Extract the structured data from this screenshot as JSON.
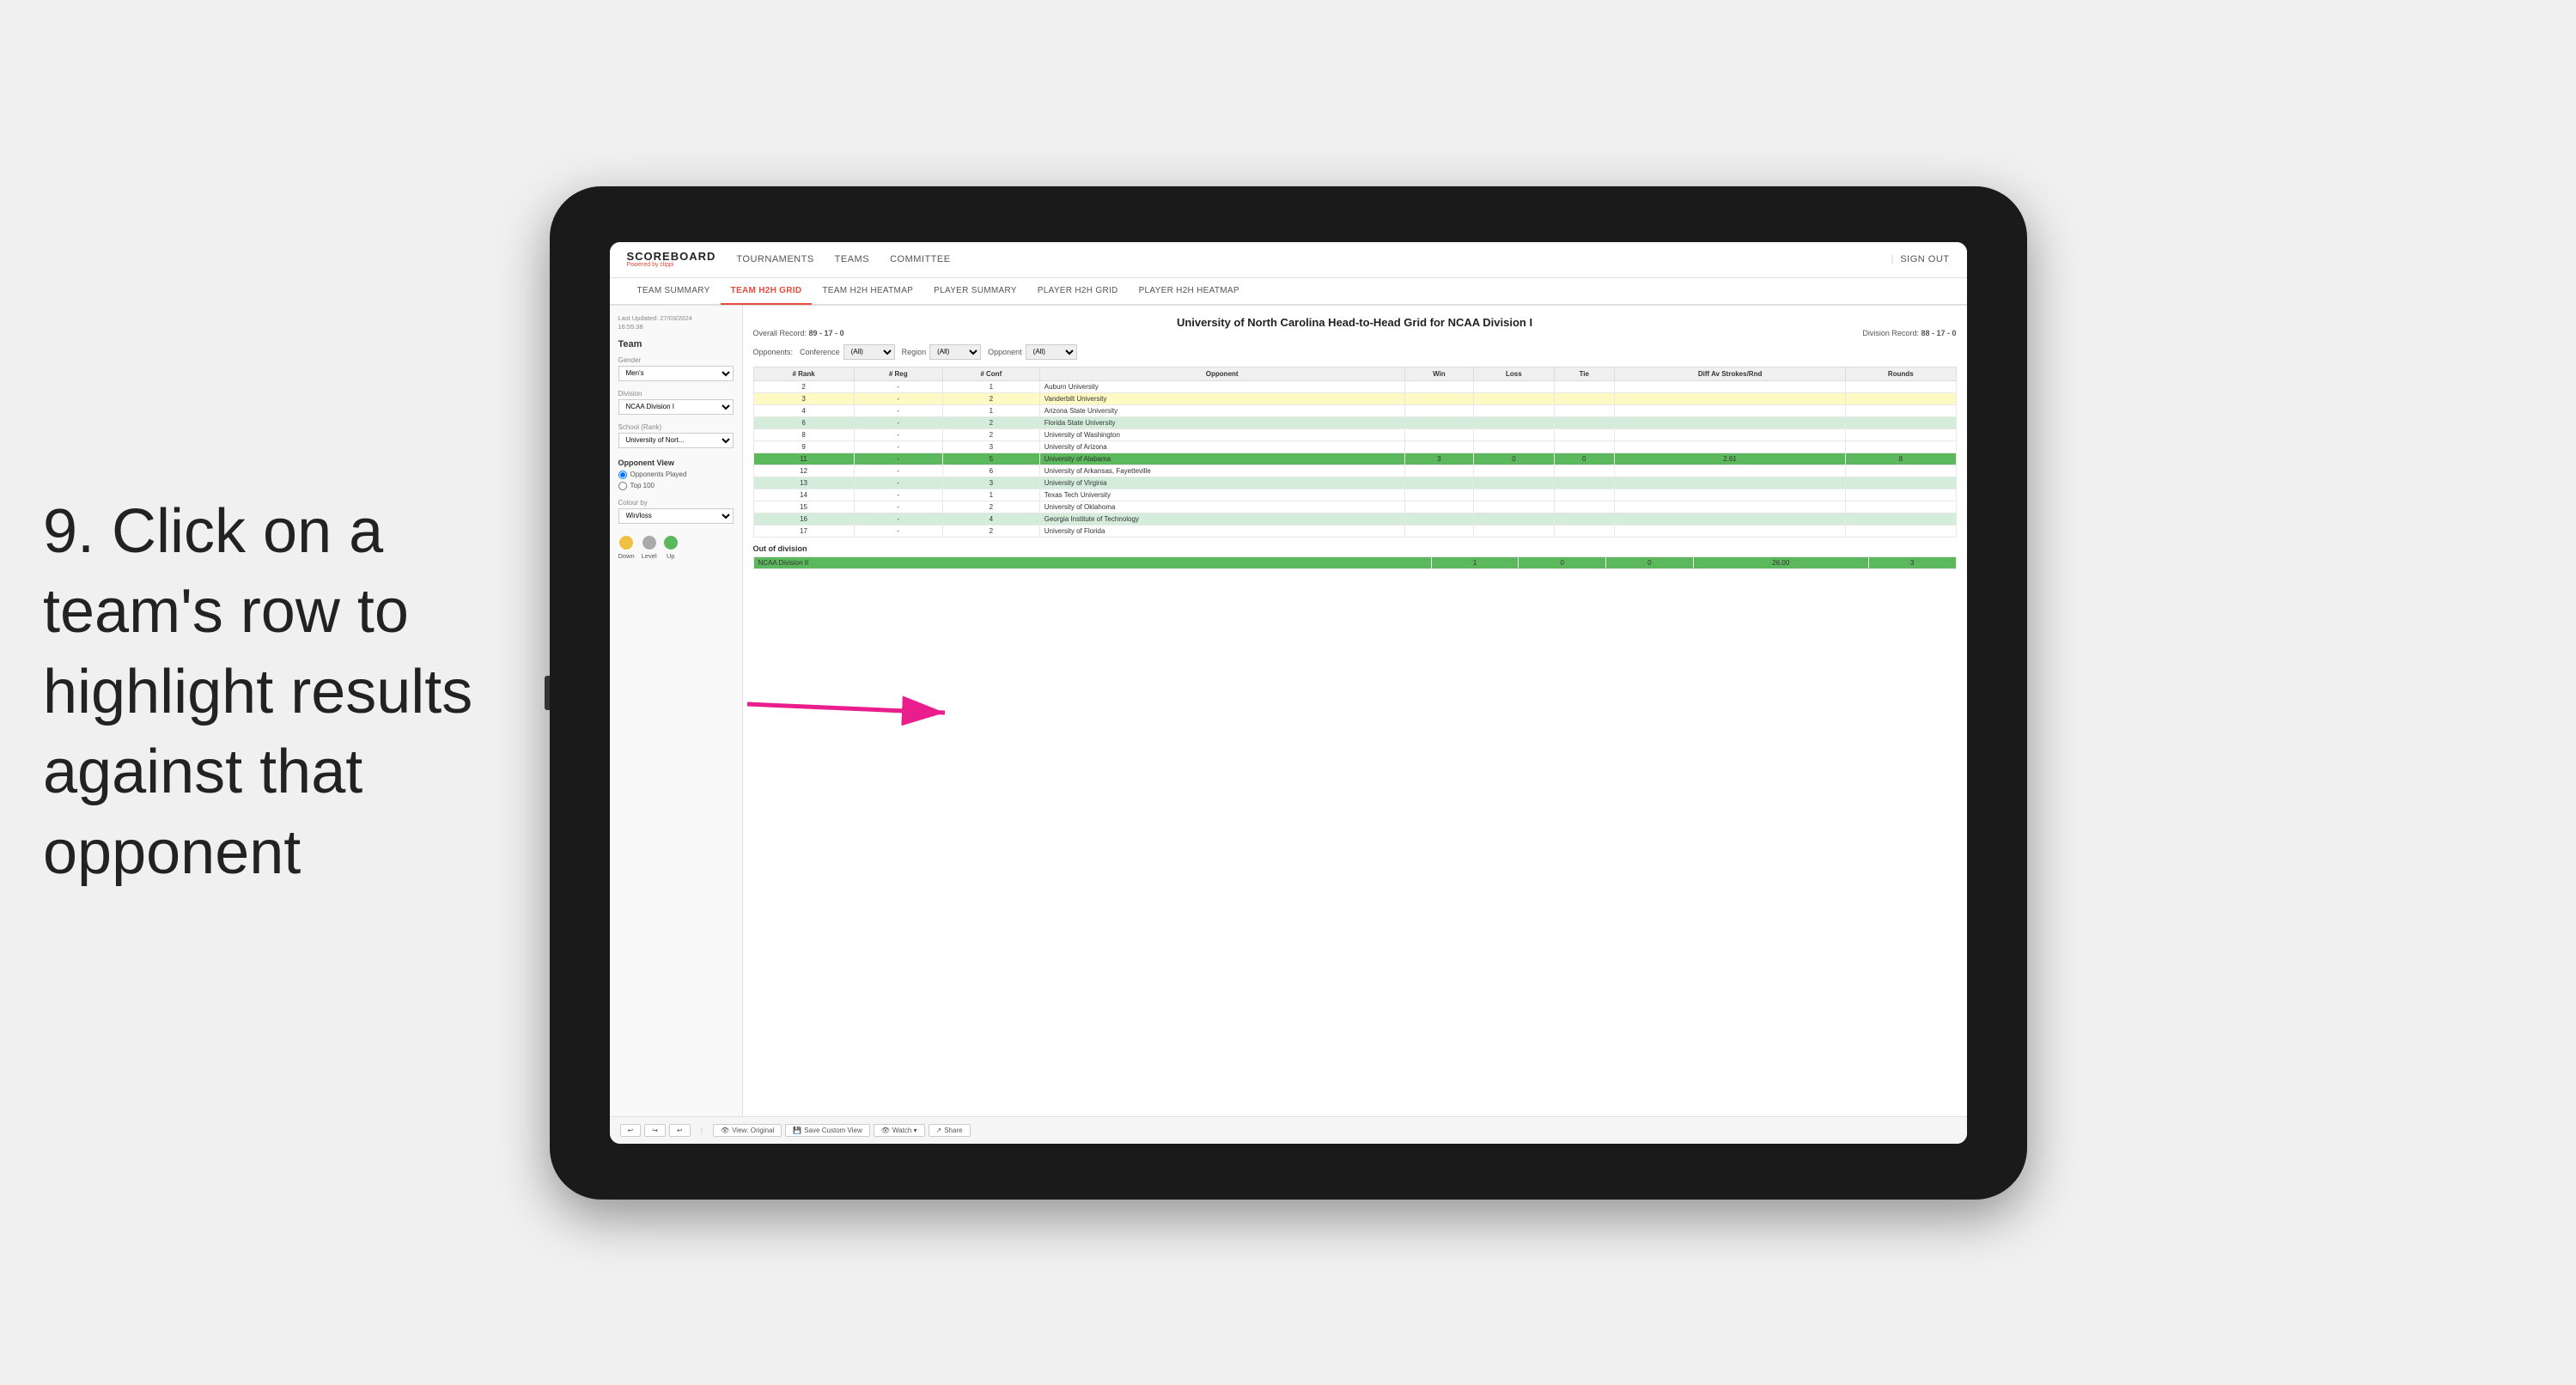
{
  "instruction": {
    "line1": "9. Click on a",
    "line2": "team's row to",
    "line3": "highlight results",
    "line4": "against that",
    "line5": "opponent"
  },
  "nav": {
    "logo": "SCOREBOARD",
    "powered_by": "Powered by ",
    "brand": "clippi",
    "items": [
      "TOURNAMENTS",
      "TEAMS",
      "COMMITTEE"
    ],
    "sign_in_separator": "|",
    "sign_out": "Sign out"
  },
  "sub_nav": {
    "items": [
      "TEAM SUMMARY",
      "TEAM H2H GRID",
      "TEAM H2H HEATMAP",
      "PLAYER SUMMARY",
      "PLAYER H2H GRID",
      "PLAYER H2H HEATMAP"
    ],
    "active": "TEAM H2H GRID"
  },
  "sidebar": {
    "timestamp_label": "Last Updated: 27/03/2024",
    "timestamp_time": "16:55:38",
    "team_label": "Team",
    "gender_label": "Gender",
    "gender_value": "Men's",
    "division_label": "Division",
    "division_value": "NCAA Division I",
    "school_label": "School (Rank)",
    "school_value": "University of Nort...",
    "opponent_view_label": "Opponent View",
    "radio_opponents": "Opponents Played",
    "radio_top100": "Top 100",
    "colour_by_label": "Colour by",
    "colour_by_value": "Win/loss",
    "legend": {
      "down": "Down",
      "level": "Level",
      "up": "Up"
    }
  },
  "grid": {
    "title": "University of North Carolina Head-to-Head Grid for NCAA Division I",
    "overall_record_label": "Overall Record:",
    "overall_record": "89 - 17 - 0",
    "division_record_label": "Division Record:",
    "division_record": "88 - 17 - 0",
    "filters": {
      "opponents_label": "Opponents:",
      "conference_label": "Conference",
      "conference_value": "(All)",
      "region_label": "Region",
      "region_value": "(All)",
      "opponent_label": "Opponent",
      "opponent_value": "(All)"
    },
    "columns": [
      "# Rank",
      "# Reg",
      "# Conf",
      "Opponent",
      "Win",
      "Loss",
      "Tie",
      "Diff Av Strokes/Rnd",
      "Rounds"
    ],
    "rows": [
      {
        "rank": "2",
        "reg": "-",
        "conf": "1",
        "opponent": "Auburn University",
        "win": "",
        "loss": "",
        "tie": "",
        "diff": "",
        "rounds": "",
        "style": "normal"
      },
      {
        "rank": "3",
        "reg": "-",
        "conf": "2",
        "opponent": "Vanderbilt University",
        "win": "",
        "loss": "",
        "tie": "",
        "diff": "",
        "rounds": "",
        "style": "yellow-light"
      },
      {
        "rank": "4",
        "reg": "-",
        "conf": "1",
        "opponent": "Arizona State University",
        "win": "",
        "loss": "",
        "tie": "",
        "diff": "",
        "rounds": "",
        "style": "normal"
      },
      {
        "rank": "6",
        "reg": "-",
        "conf": "2",
        "opponent": "Florida State University",
        "win": "",
        "loss": "",
        "tie": "",
        "diff": "",
        "rounds": "",
        "style": "green-light"
      },
      {
        "rank": "8",
        "reg": "-",
        "conf": "2",
        "opponent": "University of Washington",
        "win": "",
        "loss": "",
        "tie": "",
        "diff": "",
        "rounds": "",
        "style": "normal"
      },
      {
        "rank": "9",
        "reg": "-",
        "conf": "3",
        "opponent": "University of Arizona",
        "win": "",
        "loss": "",
        "tie": "",
        "diff": "",
        "rounds": "",
        "style": "normal"
      },
      {
        "rank": "11",
        "reg": "-",
        "conf": "5",
        "opponent": "University of Alabama",
        "win": "3",
        "loss": "0",
        "tie": "0",
        "diff": "2.61",
        "rounds": "8",
        "style": "highlighted"
      },
      {
        "rank": "12",
        "reg": "-",
        "conf": "6",
        "opponent": "University of Arkansas, Fayetteville",
        "win": "",
        "loss": "",
        "tie": "",
        "diff": "",
        "rounds": "",
        "style": "normal"
      },
      {
        "rank": "13",
        "reg": "-",
        "conf": "3",
        "opponent": "University of Virginia",
        "win": "",
        "loss": "",
        "tie": "",
        "diff": "",
        "rounds": "",
        "style": "green-light"
      },
      {
        "rank": "14",
        "reg": "-",
        "conf": "1",
        "opponent": "Texas Tech University",
        "win": "",
        "loss": "",
        "tie": "",
        "diff": "",
        "rounds": "",
        "style": "normal"
      },
      {
        "rank": "15",
        "reg": "-",
        "conf": "2",
        "opponent": "University of Oklahoma",
        "win": "",
        "loss": "",
        "tie": "",
        "diff": "",
        "rounds": "",
        "style": "normal"
      },
      {
        "rank": "16",
        "reg": "-",
        "conf": "4",
        "opponent": "Georgia Institute of Technology",
        "win": "",
        "loss": "",
        "tie": "",
        "diff": "",
        "rounds": "",
        "style": "green-light"
      },
      {
        "rank": "17",
        "reg": "-",
        "conf": "2",
        "opponent": "University of Florida",
        "win": "",
        "loss": "",
        "tie": "",
        "diff": "",
        "rounds": "",
        "style": "normal"
      }
    ],
    "out_of_division_label": "Out of division",
    "out_of_division_rows": [
      {
        "opponent": "NCAA Division II",
        "win": "1",
        "loss": "0",
        "tie": "0",
        "diff": "26.00",
        "rounds": "3",
        "style": "highlighted"
      }
    ]
  },
  "toolbar": {
    "undo": "↩",
    "redo": "↪",
    "view_original": "View: Original",
    "save_custom": "Save Custom View",
    "watch": "Watch ▾",
    "share": "Share"
  }
}
